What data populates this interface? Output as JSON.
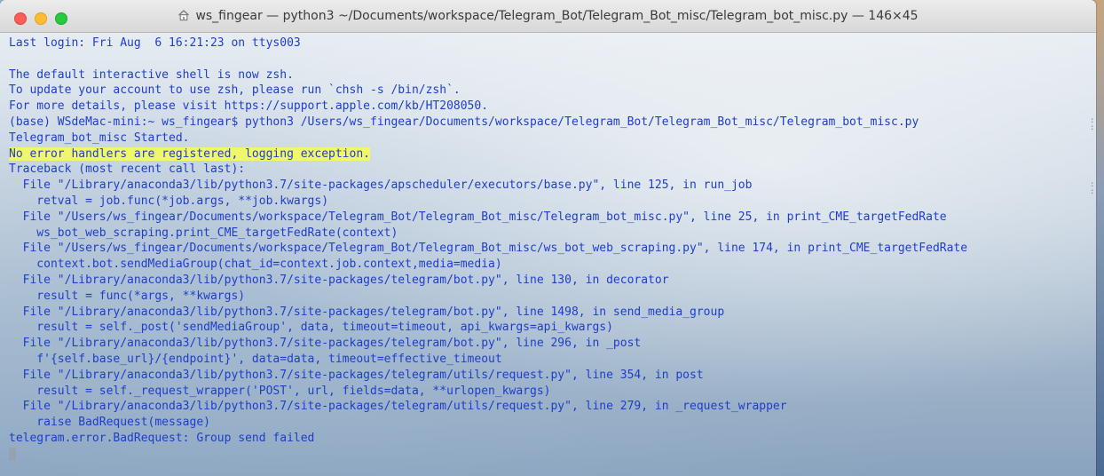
{
  "window": {
    "title": "ws_fingear — python3 ~/Documents/workspace/Telegram_Bot/Telegram_Bot_misc/Telegram_bot_misc.py — 146×45",
    "icon": "home-folder-icon"
  },
  "terminal": {
    "text_color": "#1e3ec9",
    "highlight_color": "#f1f76b",
    "lines": [
      "Last login: Fri Aug  6 16:21:23 on ttys003",
      "",
      "The default interactive shell is now zsh.",
      "To update your account to use zsh, please run `chsh -s /bin/zsh`.",
      "For more details, please visit https://support.apple.com/kb/HT208050.",
      "(base) WSdeMac-mini:~ ws_fingear$ python3 /Users/ws_fingear/Documents/workspace/Telegram_Bot/Telegram_Bot_misc/Telegram_bot_misc.py",
      "Telegram_bot_misc Started.",
      "No error handlers are registered, logging exception.",
      "Traceback (most recent call last):",
      "  File \"/Library/anaconda3/lib/python3.7/site-packages/apscheduler/executors/base.py\", line 125, in run_job",
      "    retval = job.func(*job.args, **job.kwargs)",
      "  File \"/Users/ws_fingear/Documents/workspace/Telegram_Bot/Telegram_Bot_misc/Telegram_bot_misc.py\", line 25, in print_CME_targetFedRate",
      "    ws_bot_web_scraping.print_CME_targetFedRate(context)",
      "  File \"/Users/ws_fingear/Documents/workspace/Telegram_Bot/Telegram_Bot_misc/ws_bot_web_scraping.py\", line 174, in print_CME_targetFedRate",
      "    context.bot.sendMediaGroup(chat_id=context.job.context,media=media)",
      "  File \"/Library/anaconda3/lib/python3.7/site-packages/telegram/bot.py\", line 130, in decorator",
      "    result = func(*args, **kwargs)",
      "  File \"/Library/anaconda3/lib/python3.7/site-packages/telegram/bot.py\", line 1498, in send_media_group",
      "    result = self._post('sendMediaGroup', data, timeout=timeout, api_kwargs=api_kwargs)",
      "  File \"/Library/anaconda3/lib/python3.7/site-packages/telegram/bot.py\", line 296, in _post",
      "    f'{self.base_url}/{endpoint}', data=data, timeout=effective_timeout",
      "  File \"/Library/anaconda3/lib/python3.7/site-packages/telegram/utils/request.py\", line 354, in post",
      "    result = self._request_wrapper('POST', url, fields=data, **urlopen_kwargs)",
      "  File \"/Library/anaconda3/lib/python3.7/site-packages/telegram/utils/request.py\", line 279, in _request_wrapper",
      "    raise BadRequest(message)",
      "telegram.error.BadRequest: Group send failed"
    ],
    "highlighted_line_index": 7
  }
}
